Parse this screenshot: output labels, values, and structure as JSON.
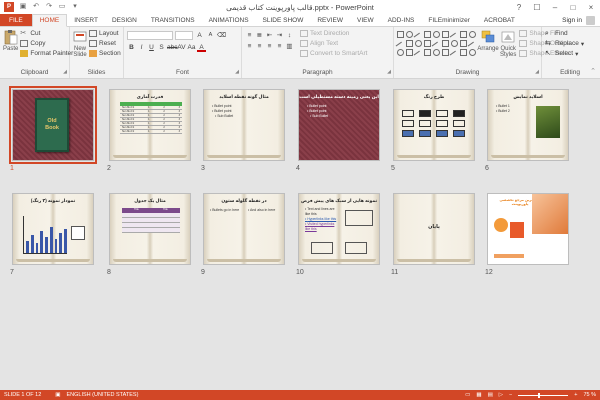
{
  "window": {
    "title": "قالب پاورپوینت کتاب قدیمی.pptx - PowerPoint",
    "controls": [
      "?",
      "☐",
      "–",
      "□",
      "×"
    ]
  },
  "tabs": [
    {
      "label": "FILE"
    },
    {
      "label": "HOME"
    },
    {
      "label": "INSERT"
    },
    {
      "label": "DESIGN"
    },
    {
      "label": "TRANSITIONS"
    },
    {
      "label": "ANIMATIONS"
    },
    {
      "label": "SLIDE SHOW"
    },
    {
      "label": "REVIEW"
    },
    {
      "label": "VIEW"
    },
    {
      "label": "ADD-INS"
    },
    {
      "label": "FILEminimizer"
    },
    {
      "label": "ACROBAT"
    }
  ],
  "signin": "Sign in",
  "ribbon": {
    "clipboard": {
      "label": "Clipboard",
      "paste": "Paste",
      "cut": "Cut",
      "copy": "Copy",
      "format_painter": "Format Painter"
    },
    "slides": {
      "label": "Slides",
      "new_slide": "New",
      "new_slide2": "Slide",
      "layout": "Layout",
      "reset": "Reset",
      "section": "Section"
    },
    "font": {
      "label": "Font"
    },
    "paragraph": {
      "label": "Paragraph",
      "text_direction": "Text Direction",
      "align_text": "Align Text",
      "convert_smartart": "Convert to SmartArt"
    },
    "drawing": {
      "label": "Drawing",
      "arrange": "Arrange",
      "quick_styles": "Quick",
      "quick_styles2": "Styles",
      "shape_fill": "Shape Fill",
      "shape_outline": "Shape Outline",
      "shape_effects": "Shape Effects"
    },
    "editing": {
      "label": "Editing",
      "find": "Find",
      "replace": "Replace",
      "select": "Select"
    }
  },
  "slides": [
    {
      "num": "1",
      "title": "",
      "cover": "Old",
      "cover2": "Book"
    },
    {
      "num": "2",
      "title": "قدرت آماری",
      "table": [
        [
          "Sun Mo Fri",
          "1",
          "2",
          "3"
        ],
        [
          "Sun Mo Fri",
          "1",
          "2",
          "3"
        ],
        [
          "Sun Mo Fri",
          "1",
          "2",
          "3"
        ],
        [
          "Sun Mo Fri",
          "1",
          "2",
          "3"
        ],
        [
          "Sun Mo Fri",
          "1",
          "2",
          "3"
        ],
        [
          "Sun Mo Fri",
          "1",
          "2",
          "3"
        ],
        [
          "Sun Mo Fri",
          "1",
          "2",
          "3"
        ]
      ]
    },
    {
      "num": "3",
      "title": "مثال گونه نقطه اسلاید",
      "bullets": [
        "Bullet point",
        "Bullet point",
        "Sub Bullet"
      ]
    },
    {
      "num": "4",
      "title": "این یعنی زمینه دسته مستطیلی است",
      "bullets": [
        "Bullet point",
        "Bullet point",
        "Sub Bullet"
      ]
    },
    {
      "num": "5",
      "title": "طرح رنگ"
    },
    {
      "num": "6",
      "title": "اسلاید نمایش",
      "bullets": [
        "Bullet 1",
        "Bullet 2"
      ]
    },
    {
      "num": "7",
      "title": "نمودار نمونه (۳ رنگ)"
    },
    {
      "num": "8",
      "title": "مثال یک جدول",
      "bullets": [
        "Title",
        "Title"
      ]
    },
    {
      "num": "9",
      "title": "در نقطه گلوله ستون",
      "bullets": [
        "Bullets go in here",
        "And also in here"
      ]
    },
    {
      "num": "10",
      "title": "نمونه هایی از سبک های پیش فرض",
      "bullets": [
        "Text and lines are like this",
        "Hyperlinks like this",
        "Visited hyperlinks like this"
      ]
    },
    {
      "num": "11",
      "title": "پایان"
    },
    {
      "num": "12",
      "title": "بزرگترین مرجع تخصصی پاورپوینت"
    }
  ],
  "status": {
    "slide": "SLIDE 1 OF 12",
    "language": "ENGLISH (UNITED STATES)",
    "zoom": "75 %"
  }
}
